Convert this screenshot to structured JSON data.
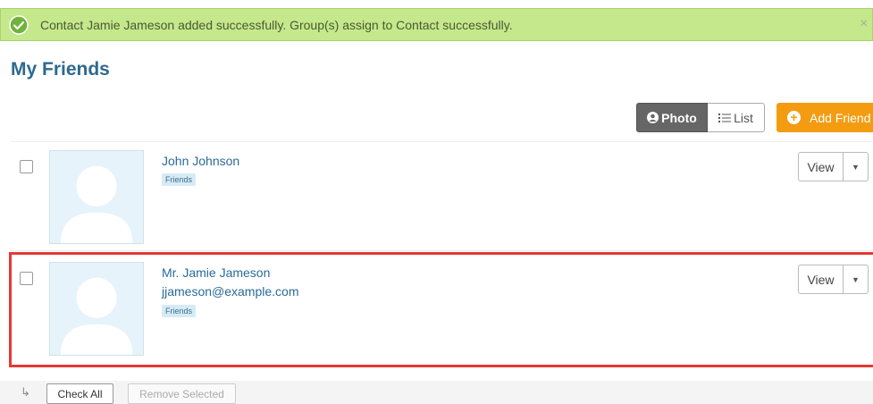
{
  "alert": {
    "message": "Contact Jamie Jameson added successfully. Group(s) assign to Contact successfully.",
    "close_label": "×",
    "icon": "check-circle-icon",
    "color": "#c5e88d"
  },
  "page": {
    "title": "My Friends"
  },
  "toolbar": {
    "photo_label": "Photo",
    "list_label": "List",
    "add_label": "Add Friend",
    "photo_icon": "user-circle-icon",
    "list_icon": "list-icon",
    "add_icon": "plus-circle-icon",
    "add_color": "#f39c12"
  },
  "contacts": [
    {
      "name": "John Johnson",
      "email": "",
      "tag": "Friends",
      "view_label": "View",
      "dropdown_icon": "caret-down-icon"
    },
    {
      "name": "Mr. Jamie Jameson",
      "email": "jjameson@example.com",
      "tag": "Friends",
      "view_label": "View",
      "dropdown_icon": "caret-down-icon",
      "highlighted": true,
      "highlight_color": "#e53935"
    }
  ],
  "footer": {
    "arrow_icon": "corner-arrow-icon",
    "check_all_label": "Check All",
    "remove_selected_label": "Remove Selected"
  }
}
